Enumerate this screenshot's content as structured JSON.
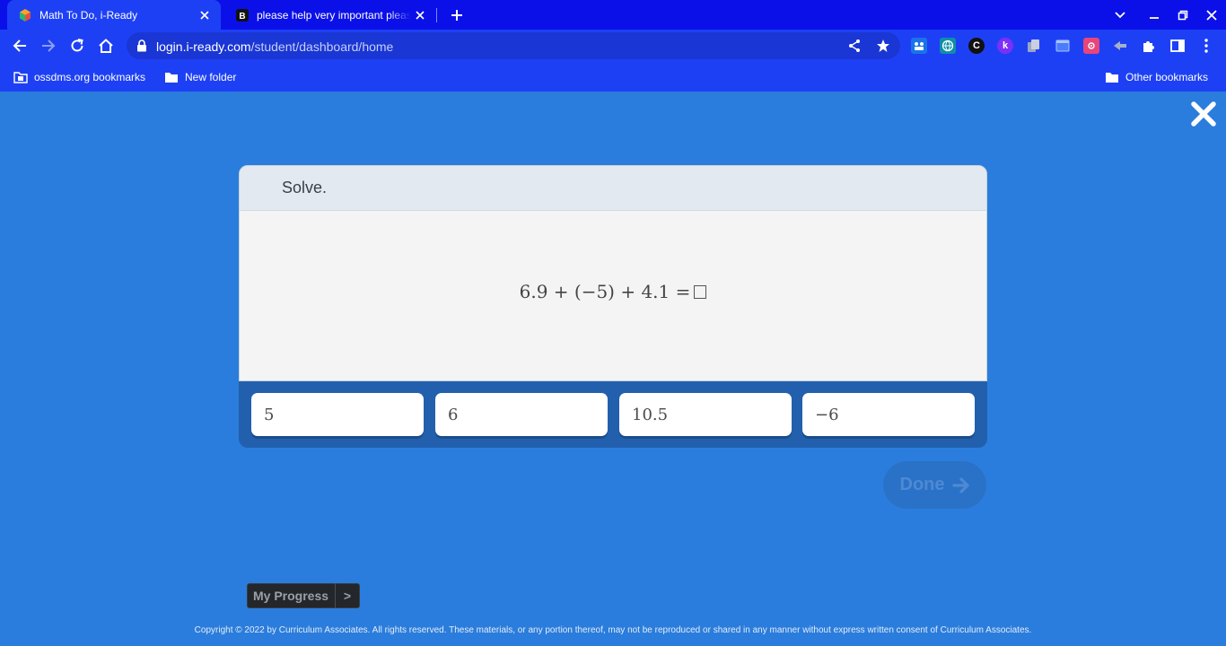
{
  "browser": {
    "tabs": [
      {
        "title": "Math To Do, i-Ready",
        "active": true
      },
      {
        "title": "please help very important please",
        "active": false
      }
    ],
    "address": {
      "domain": "login.i-ready.com",
      "path": "/student/dashboard/home"
    },
    "bookmarks": [
      {
        "label": "ossdms.org bookmarks"
      },
      {
        "label": "New folder"
      }
    ],
    "other_bookmarks": "Other bookmarks",
    "colors": {
      "tabbar": "#0b10e8",
      "toolbar": "#1e40f5"
    }
  },
  "question": {
    "prompt": "Solve.",
    "equation": "6.9 + (−5) + 4.1 ="
  },
  "answers": [
    {
      "label": "5"
    },
    {
      "label": "6"
    },
    {
      "label": "10.5"
    },
    {
      "label": "−6"
    }
  ],
  "done_label": "Done",
  "my_progress": {
    "label": "My Progress",
    "arrow": ">"
  },
  "copyright": "Copyright © 2022 by Curriculum Associates. All rights reserved. These materials, or any portion thereof, may not be reproduced or shared in any manner without express written consent of Curriculum Associates.",
  "colors": {
    "page_bg": "#2a7ddc",
    "answer_tray": "#2260ae",
    "card_header": "#e3e9f1"
  }
}
